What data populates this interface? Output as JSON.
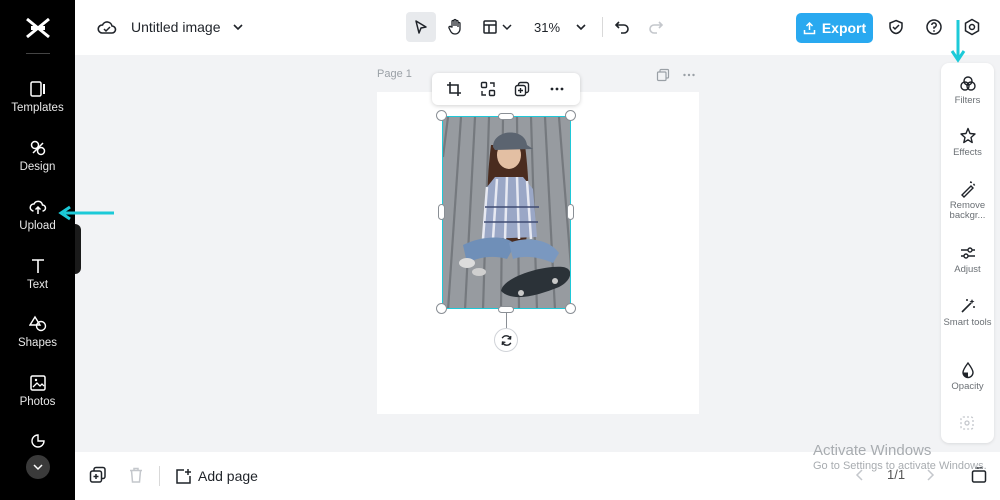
{
  "colors": {
    "accent": "#29a9f0",
    "selection": "#1fc8d8",
    "annotation_arrow": "#1ccad8",
    "sidebar_bg": "#000000"
  },
  "sidebar": {
    "items": [
      {
        "label": "Templates",
        "icon": "templates-icon"
      },
      {
        "label": "Design",
        "icon": "design-icon"
      },
      {
        "label": "Upload",
        "icon": "upload-cloud-icon"
      },
      {
        "label": "Text",
        "icon": "text-icon"
      },
      {
        "label": "Shapes",
        "icon": "shapes-icon"
      },
      {
        "label": "Photos",
        "icon": "photos-icon"
      }
    ]
  },
  "header": {
    "title": "Untitled image",
    "zoom": "31%",
    "export_label": "Export"
  },
  "canvas": {
    "page_label": "Page 1"
  },
  "right_panel": {
    "items": [
      {
        "label": "Filters",
        "icon": "filters-icon"
      },
      {
        "label": "Effects",
        "icon": "effects-icon"
      },
      {
        "label": "Remove backgr...",
        "icon": "remove-background-icon"
      },
      {
        "label": "Adjust",
        "icon": "adjust-icon"
      },
      {
        "label": "Smart tools",
        "icon": "smart-tools-icon"
      },
      {
        "label": "Opacity",
        "icon": "opacity-icon"
      }
    ]
  },
  "footer": {
    "add_page_label": "Add page",
    "page_count": "1/1"
  },
  "watermark": {
    "title": "Activate Windows",
    "subtitle": "Go to Settings to activate Windows."
  }
}
